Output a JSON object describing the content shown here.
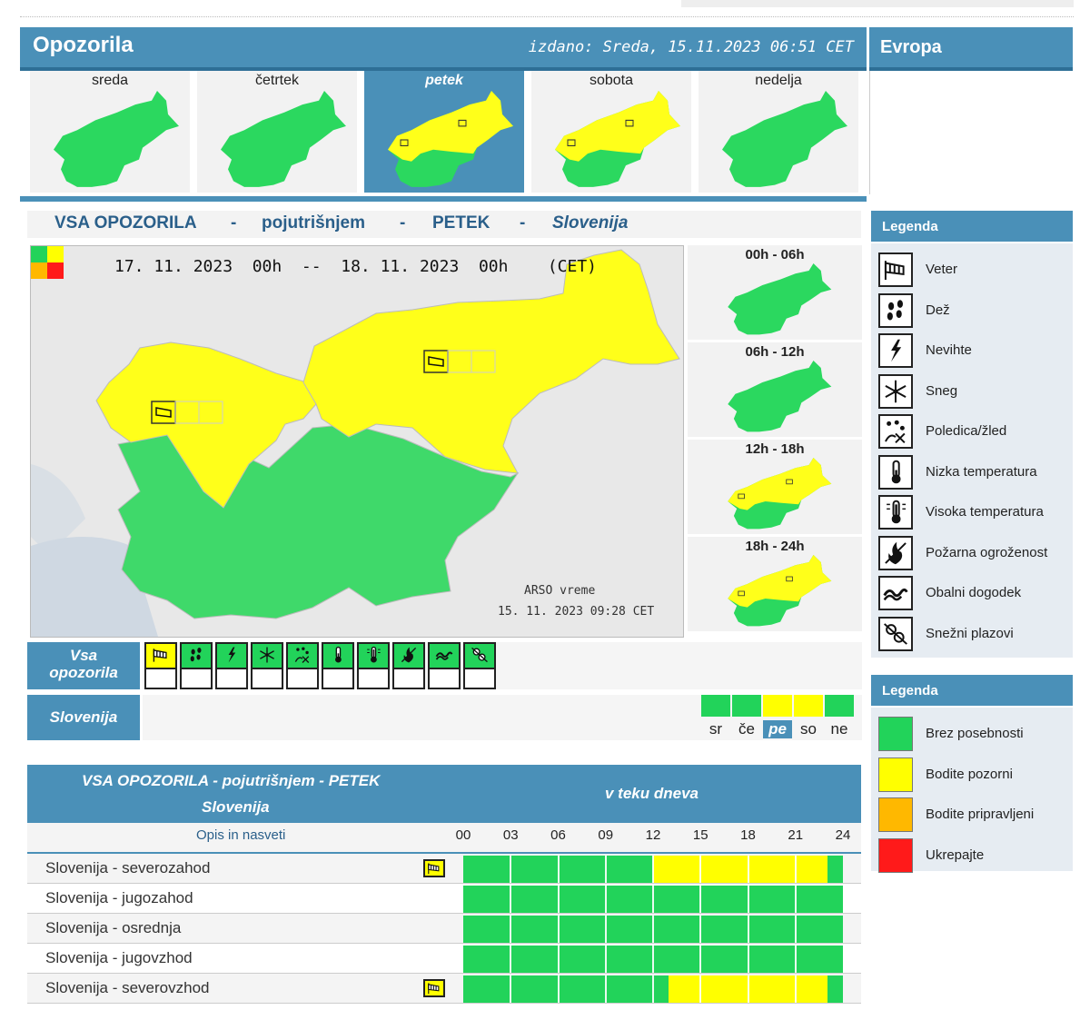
{
  "header": {
    "title": "Opozorila",
    "issued": "izdano: Sreda, 15.11.2023 06:51 CET",
    "europe": "Evropa"
  },
  "days": [
    {
      "label": "sreda",
      "active": false
    },
    {
      "label": "četrtek",
      "active": false
    },
    {
      "label": "petek",
      "active": true
    },
    {
      "label": "sobota",
      "active": false
    },
    {
      "label": "nedelja",
      "active": false
    }
  ],
  "section": {
    "part1": "VSA OPOZORILA",
    "sep": "-",
    "part2": "pojutrišnjem",
    "part3": "PETEK",
    "part4": "Slovenija"
  },
  "main_map": {
    "date_range": "17. 11. 2023  00h  --  18. 11. 2023  00h    (CET)",
    "credit_line1": "ARSO vreme",
    "credit_line2": "15. 11. 2023  09:28 CET"
  },
  "periods": [
    {
      "label": "00h - 06h",
      "warning": "green"
    },
    {
      "label": "06h - 12h",
      "warning": "green"
    },
    {
      "label": "12h - 18h",
      "warning": "yellow"
    },
    {
      "label": "18h - 24h",
      "warning": "yellow"
    }
  ],
  "icon_row": {
    "vsa_line1": "Vsa",
    "vsa_line2": "opozorila",
    "icons": [
      {
        "name": "wind-icon",
        "level": "yellow"
      },
      {
        "name": "rain-icon",
        "level": "green"
      },
      {
        "name": "thunderstorm-icon",
        "level": "green"
      },
      {
        "name": "snow-icon",
        "level": "green"
      },
      {
        "name": "ice-icon",
        "level": "green"
      },
      {
        "name": "low-temperature-icon",
        "level": "green"
      },
      {
        "name": "high-temperature-icon",
        "level": "green"
      },
      {
        "name": "fire-icon",
        "level": "green"
      },
      {
        "name": "coastal-icon",
        "level": "green"
      },
      {
        "name": "avalanche-icon",
        "level": "green"
      }
    ]
  },
  "slovenia_row": {
    "label": "Slovenija",
    "days": [
      {
        "abbr": "sr",
        "color": "#22d35a",
        "current": false
      },
      {
        "abbr": "če",
        "color": "#22d35a",
        "current": false
      },
      {
        "abbr": "pe",
        "color": "#ffff00",
        "current": true
      },
      {
        "abbr": "so",
        "color": "#ffff00",
        "current": false
      },
      {
        "abbr": "ne",
        "color": "#22d35a",
        "current": false
      }
    ]
  },
  "table": {
    "header_line1": "VSA OPOZORILA - pojutrišnjem - PETEK",
    "header_line2": "Slovenija",
    "header_right": "v teku dneva",
    "opis": "Opis in nasveti",
    "hours": [
      "00",
      "03",
      "06",
      "09",
      "12",
      "15",
      "18",
      "21",
      "24"
    ],
    "rows": [
      {
        "name": "Slovenija - severozahod",
        "wind_icon": true,
        "yellow_from": 12,
        "yellow_to": 23
      },
      {
        "name": "Slovenija - jugozahod",
        "wind_icon": false,
        "yellow_from": null,
        "yellow_to": null
      },
      {
        "name": "Slovenija - osrednja",
        "wind_icon": false,
        "yellow_from": null,
        "yellow_to": null
      },
      {
        "name": "Slovenija - jugovzhod",
        "wind_icon": false,
        "yellow_from": null,
        "yellow_to": null
      },
      {
        "name": "Slovenija - severovzhod",
        "wind_icon": true,
        "yellow_from": 13,
        "yellow_to": 23
      }
    ]
  },
  "legend_hazards": {
    "title": "Legenda",
    "items": [
      {
        "label": "Veter",
        "icon": "wind-icon"
      },
      {
        "label": "Dež",
        "icon": "rain-icon"
      },
      {
        "label": "Nevihte",
        "icon": "thunderstorm-icon"
      },
      {
        "label": "Sneg",
        "icon": "snow-icon"
      },
      {
        "label": "Poledica/žled",
        "icon": "ice-icon"
      },
      {
        "label": "Nizka temperatura",
        "icon": "low-temperature-icon"
      },
      {
        "label": "Visoka temperatura",
        "icon": "high-temperature-icon"
      },
      {
        "label": "Požarna ogroženost",
        "icon": "fire-icon"
      },
      {
        "label": "Obalni dogodek",
        "icon": "coastal-icon"
      },
      {
        "label": "Snežni plazovi",
        "icon": "avalanche-icon"
      }
    ]
  },
  "legend_levels": {
    "title": "Legenda",
    "items": [
      {
        "label": "Brez posebnosti",
        "color": "#22d35a"
      },
      {
        "label": "Bodite pozorni",
        "color": "#ffff00"
      },
      {
        "label": "Bodite pripravljeni",
        "color": "#ffb800"
      },
      {
        "label": "Ukrepajte",
        "color": "#ff1a1a"
      }
    ]
  },
  "colors": {
    "green": "#22d35a",
    "yellow": "#ffff00",
    "orange": "#ffb800",
    "red": "#ff1a1a",
    "accent": "#4a90b8"
  }
}
